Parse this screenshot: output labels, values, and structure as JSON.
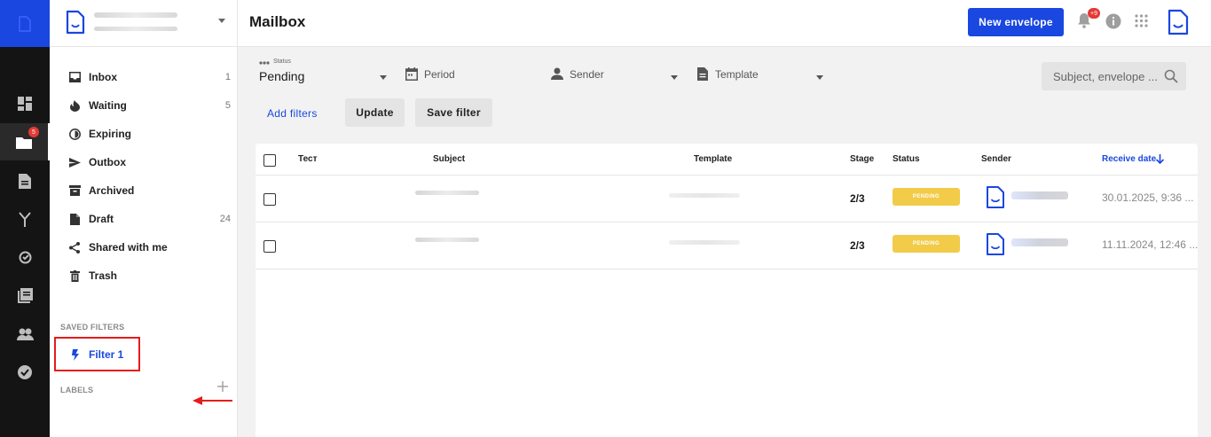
{
  "header": {
    "title": "Mailbox",
    "new_envelope_label": "New envelope",
    "notification_badge": "+9"
  },
  "rail": {
    "folder_badge": "5"
  },
  "sidebar": {
    "items": [
      {
        "label": "Inbox",
        "count": "1",
        "icon": "inbox-icon"
      },
      {
        "label": "Waiting",
        "count": "5",
        "icon": "fire-icon"
      },
      {
        "label": "Expiring",
        "count": "",
        "icon": "clock-half-icon"
      },
      {
        "label": "Outbox",
        "count": "",
        "icon": "send-icon"
      },
      {
        "label": "Archived",
        "count": "",
        "icon": "archive-icon"
      },
      {
        "label": "Draft",
        "count": "24",
        "icon": "draft-icon"
      },
      {
        "label": "Shared with me",
        "count": "",
        "icon": "share-icon"
      },
      {
        "label": "Trash",
        "count": "",
        "icon": "trash-icon"
      }
    ],
    "saved_filters_heading": "SAVED FILTERS",
    "filter_label": "Filter 1",
    "labels_heading": "LABELS"
  },
  "filters": {
    "status_caption": "Status",
    "status_value": "Pending",
    "period_label": "Period",
    "sender_label": "Sender",
    "template_label": "Template",
    "search_placeholder": "Subject, envelope ...",
    "add_filters_label": "Add filters",
    "update_label": "Update",
    "save_filter_label": "Save filter"
  },
  "table": {
    "columns": [
      "Тест",
      "Subject",
      "Template",
      "Stage",
      "Status",
      "Sender",
      "Receive date"
    ],
    "rows": [
      {
        "stage": "2/3",
        "status": "PENDING",
        "date": "30.01.2025, 9:36 ..."
      },
      {
        "stage": "2/3",
        "status": "PENDING",
        "date": "11.11.2024, 12:46 ..."
      }
    ]
  },
  "colors": {
    "accent": "#1a47e0",
    "pending": "#f2cb48",
    "badge": "#e53935",
    "highlight": "#e51c1c"
  }
}
